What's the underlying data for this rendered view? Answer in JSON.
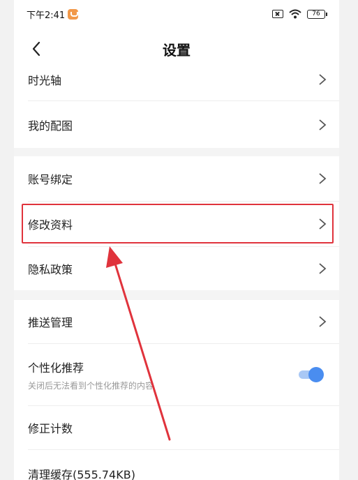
{
  "status": {
    "time": "下午2:41",
    "battery": "76"
  },
  "header": {
    "title": "设置"
  },
  "settings": {
    "timeline": "时光轴",
    "my_images": "我的配图",
    "account_binding": "账号绑定",
    "edit_profile": "修改资料",
    "privacy_policy": "隐私政策",
    "push_management": "推送管理",
    "personalized_rec": "个性化推荐",
    "personalized_rec_desc": "关闭后无法看到个性化推荐的内容",
    "correction_count": "修正计数",
    "clear_cache": "清理缓存(555.74KB)"
  },
  "toggle_state": {
    "personalized_rec_on": true
  },
  "colors": {
    "highlight": "#e0333c",
    "toggle_on": "#4a8df0"
  }
}
